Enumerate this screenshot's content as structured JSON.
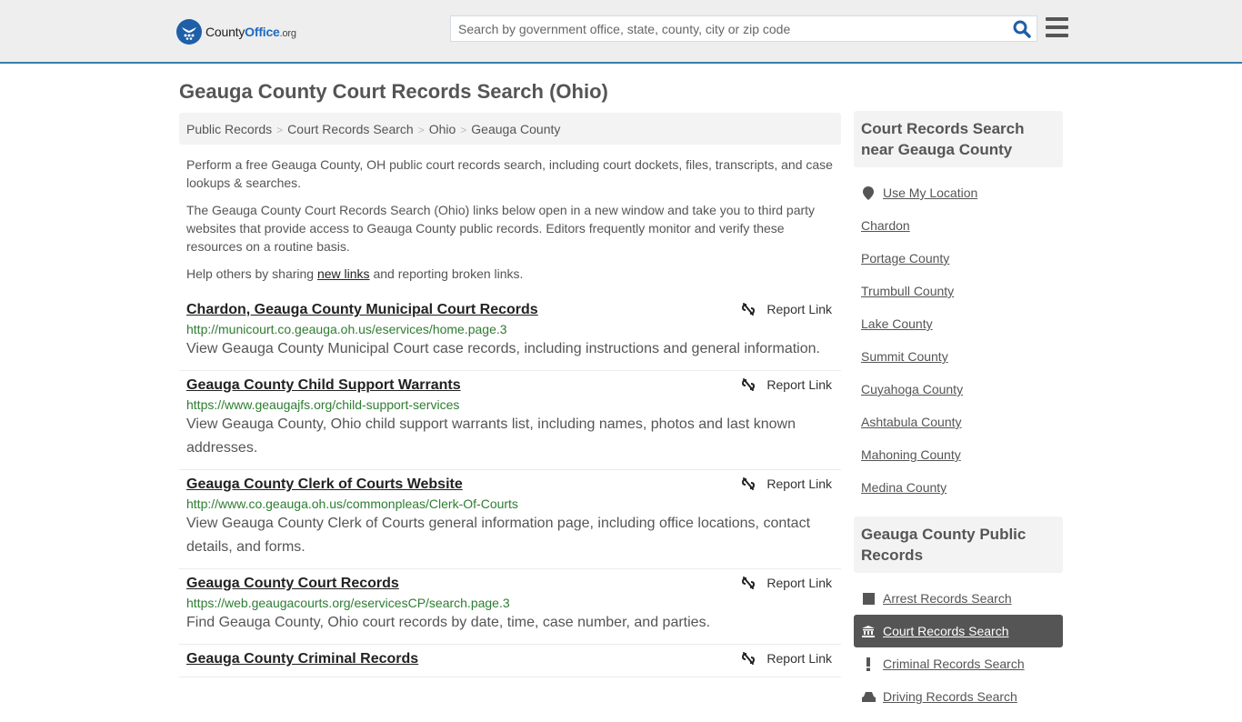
{
  "header": {
    "logo": {
      "prefix": "County",
      "brand": "Office",
      "suffix": ".org"
    },
    "search": {
      "placeholder": "Search by government office, state, county, city or zip code",
      "value": ""
    },
    "search_icon": "search-icon",
    "menu_icon": "hamburger-menu-icon",
    "accent_color": "#3a7cab"
  },
  "page": {
    "title": "Geauga County Court Records Search (Ohio)"
  },
  "breadcrumb": [
    {
      "label": "Public Records"
    },
    {
      "label": "Court Records Search"
    },
    {
      "label": "Ohio"
    },
    {
      "label": "Geauga County"
    }
  ],
  "intro": {
    "p1": "Perform a free Geauga County, OH public court records search, including court dockets, files, transcripts, and case lookups & searches.",
    "p2": "The Geauga County Court Records Search (Ohio) links below open in a new window and take you to third party websites that provide access to Geauga County public records. Editors frequently monitor and verify these resources on a routine basis.",
    "p3_before": "Help others by sharing ",
    "p3_link": "new links",
    "p3_after": " and reporting broken links."
  },
  "results": [
    {
      "title": "Chardon, Geauga County Municipal Court Records",
      "url": "http://municourt.co.geauga.oh.us/eservices/home.page.3",
      "description": "View Geauga County Municipal Court case records, including instructions and general information.",
      "report_label": "Report Link"
    },
    {
      "title": "Geauga County Child Support Warrants",
      "url": "https://www.geaugajfs.org/child-support-services",
      "description": "View Geauga County, Ohio child support warrants list, including names, photos and last known addresses.",
      "report_label": "Report Link"
    },
    {
      "title": "Geauga County Clerk of Courts Website",
      "url": "http://www.co.geauga.oh.us/commonpleas/Clerk-Of-Courts",
      "description": "View Geauga County Clerk of Courts general information page, including office locations, contact details, and forms.",
      "report_label": "Report Link"
    },
    {
      "title": "Geauga County Court Records",
      "url": "https://web.geaugacourts.org/eservicesCP/search.page.3",
      "description": "Find Geauga County, Ohio court records by date, time, case number, and parties.",
      "report_label": "Report Link"
    },
    {
      "title": "Geauga County Criminal Records",
      "url": "",
      "description": "",
      "report_label": "Report Link"
    }
  ],
  "sidebar": {
    "nearby": {
      "heading": "Court Records Search near Geauga County",
      "use_location": "Use My Location",
      "items": [
        "Chardon",
        "Portage County",
        "Trumbull County",
        "Lake County",
        "Summit County",
        "Cuyahoga County",
        "Ashtabula County",
        "Mahoning County",
        "Medina County"
      ]
    },
    "public_records": {
      "heading": "Geauga County Public Records",
      "items": [
        {
          "label": "Arrest Records Search",
          "icon": "square-icon",
          "active": false
        },
        {
          "label": "Court Records Search",
          "icon": "courthouse-icon",
          "active": true
        },
        {
          "label": "Criminal Records Search",
          "icon": "exclamation-icon",
          "active": false
        },
        {
          "label": "Driving Records Search",
          "icon": "car-icon",
          "active": false
        }
      ]
    }
  }
}
